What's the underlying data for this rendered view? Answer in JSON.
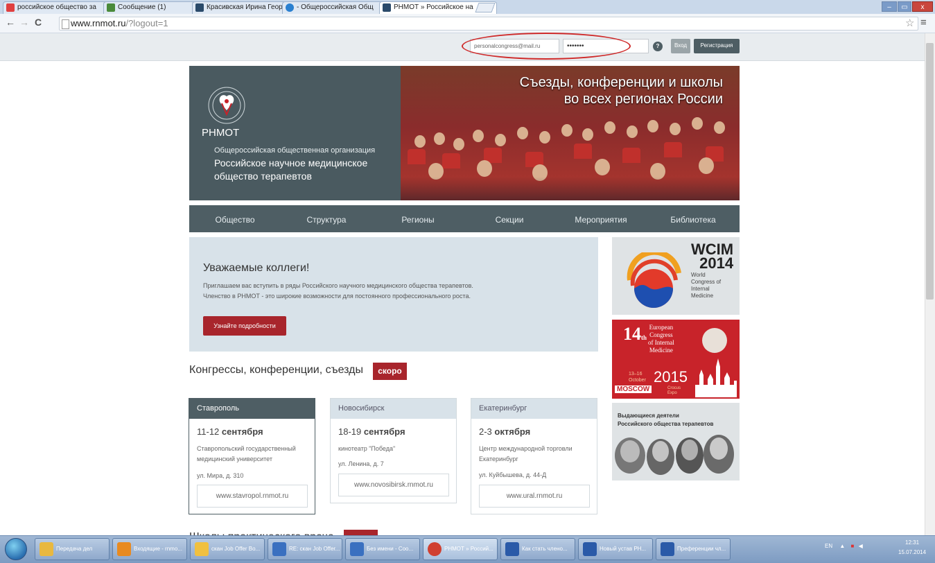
{
  "browser": {
    "tabs": [
      {
        "title": "российское общество за",
        "favicon_color": "#e04040"
      },
      {
        "title": "Сообщение (1)",
        "favicon_color": "#4a8a3a"
      },
      {
        "title": "Красивская Ирина Георг",
        "favicon_color": "#2a4a6a"
      },
      {
        "title": "- Общероссийская Общ",
        "favicon_color": "#2a80d0"
      },
      {
        "title": "РНМОТ » Российское на",
        "favicon_color": "#2a4a6a"
      }
    ],
    "window_controls": [
      "–",
      "▭",
      "x"
    ],
    "url_host": "www.rnmot.ru",
    "url_path": "/?logout=1"
  },
  "topbar": {
    "email": "personalcongress@mail.ru",
    "password_mask": "•••••••",
    "help_icon": "?",
    "login_label": "Вход",
    "register_label": "Регистрация"
  },
  "banner": {
    "headline_1": "Съезды, конференции и школы",
    "headline_2": "во всех регионах России",
    "abbr": "РНМОТ",
    "subtitle": "Общероссийская общественная организация",
    "name_1": "Российское научное медицинское",
    "name_2": "общество терапевтов",
    "logo_ring_text": "российское научное медицинское общество терапевтов"
  },
  "nav": [
    "Общество",
    "Структура",
    "Регионы",
    "Секции",
    "Мероприятия",
    "Библиотека"
  ],
  "welcome": {
    "title": "Уважаемые коллеги!",
    "line1": "Приглашаем вас вступить в ряды Российского научного медицинского общества терапевтов.",
    "line2": "Членство в РНМОТ - это широкие возможности для постоянного профессионального роста.",
    "button": "Узнайте подробности"
  },
  "congresses": {
    "title": "Конгрессы, конференции, съезды",
    "badge": "скоро",
    "items": [
      {
        "city": "Ставрополь",
        "days": "11-12",
        "month": "сентября",
        "place": "Ставропольский государственный медицинский университет",
        "address": "ул. Мира, д. 310",
        "site": "www.stavropol.rnmot.ru"
      },
      {
        "city": "Новосибирск",
        "days": "18-19",
        "month": "сентября",
        "place": "кинотеатр \"Победа\"",
        "address": "ул. Ленина, д. 7",
        "site": "www.novosibirsk.rnmot.ru"
      },
      {
        "city": "Екатеринбург",
        "days": "2-3",
        "month": "октября",
        "place": "Центр международной торговли Екатеринбург",
        "address": "ул. Куйбышева, д. 44-Д",
        "site": "www.ural.rnmot.ru"
      }
    ]
  },
  "next_section_title": "Школы практического врача",
  "sidebar": {
    "wcim": {
      "title_1": "WCIM",
      "title_2": "2014",
      "sub": [
        "World",
        "Congress of",
        "Internal",
        "Medicine"
      ]
    },
    "euro": {
      "num": "14",
      "th": "th",
      "text": [
        "European",
        "Congress",
        "of Internal",
        "Medicine"
      ],
      "dates": "13–16",
      "month": "October",
      "year": "2015",
      "city": "MOSCOW",
      "venue": "Crocus Expo"
    },
    "persons": {
      "title_1": "Выдающиеся деятели",
      "title_2": "Российского общества терапевтов"
    }
  },
  "taskbar": {
    "items": [
      {
        "label": "Передача дел",
        "icon_color": "#e8b840"
      },
      {
        "label": "Входящие - rnmo...",
        "icon_color": "#e88a20"
      },
      {
        "label": "скан Job Offer Bo...",
        "icon_color": "#f0c040"
      },
      {
        "label": "RE: скан Job Offer...",
        "icon_color": "#3a70c0"
      },
      {
        "label": "Без имени - Соо...",
        "icon_color": "#3a70c0"
      },
      {
        "label": "РНМОТ » Россий...",
        "icon_color": "#d04030"
      },
      {
        "label": "Как стать члено...",
        "icon_color": "#2a5aa8"
      },
      {
        "label": "Новый устав РН...",
        "icon_color": "#2a5aa8"
      },
      {
        "label": "Преференции чл...",
        "icon_color": "#2a5aa8"
      }
    ],
    "lang": "EN",
    "time": "12:31",
    "date": "15.07.2014"
  }
}
